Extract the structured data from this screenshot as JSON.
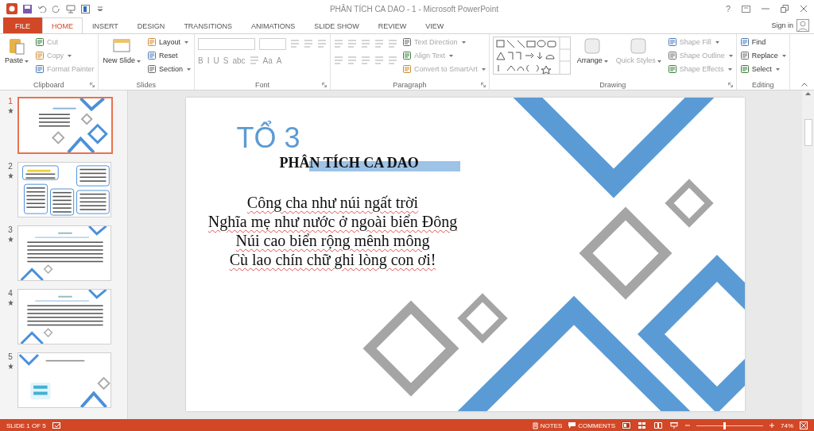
{
  "window": {
    "title": "PHÂN TÍCH CA DAO - 1 - Microsoft PowerPoint",
    "help": "?"
  },
  "tabs": [
    {
      "label": "FILE",
      "kind": "file",
      "selected": false
    },
    {
      "label": "HOME",
      "kind": "tab",
      "selected": true
    },
    {
      "label": "INSERT",
      "kind": "tab",
      "selected": false
    },
    {
      "label": "DESIGN",
      "kind": "tab",
      "selected": false
    },
    {
      "label": "TRANSITIONS",
      "kind": "tab",
      "selected": false
    },
    {
      "label": "ANIMATIONS",
      "kind": "tab",
      "selected": false
    },
    {
      "label": "SLIDE SHOW",
      "kind": "tab",
      "selected": false
    },
    {
      "label": "REVIEW",
      "kind": "tab",
      "selected": false
    },
    {
      "label": "VIEW",
      "kind": "tab",
      "selected": false
    }
  ],
  "account": {
    "label": "Sign in"
  },
  "ribbon": {
    "groups": [
      {
        "label": "Clipboard",
        "launcher": true,
        "columns": [
          [
            {
              "kind": "large",
              "label": "Paste",
              "dropdown": true,
              "disabled": false
            }
          ],
          [
            {
              "kind": "small",
              "label": "Cut",
              "dropdown": false,
              "disabled": true
            },
            {
              "kind": "small",
              "label": "Copy",
              "dropdown": true,
              "disabled": true
            },
            {
              "kind": "small",
              "label": "Format Painter",
              "dropdown": false,
              "disabled": true
            }
          ]
        ]
      },
      {
        "label": "Slides",
        "launcher": false,
        "columns": [
          [
            {
              "kind": "large",
              "label": "New Slide",
              "dropdown": true,
              "disabled": false
            }
          ],
          [
            {
              "kind": "small",
              "label": "Layout",
              "dropdown": true,
              "disabled": false
            },
            {
              "kind": "small",
              "label": "Reset",
              "dropdown": false,
              "disabled": false
            },
            {
              "kind": "small",
              "label": "Section",
              "dropdown": true,
              "disabled": false
            }
          ]
        ]
      },
      {
        "label": "Font",
        "launcher": true,
        "columns": [
          [
            {
              "kind": "row",
              "items": [
                {
                  "kind": "font_field"
                },
                {
                  "kind": "size_field"
                },
                {
                  "kind": "tool"
                },
                {
                  "kind": "tool"
                },
                {
                  "kind": "tool"
                }
              ]
            },
            {
              "kind": "row",
              "items": [
                {
                  "kind": "letter",
                  "label": "B"
                },
                {
                  "kind": "letter",
                  "label": "I"
                },
                {
                  "kind": "letter",
                  "label": "U"
                },
                {
                  "kind": "letter",
                  "label": "S"
                },
                {
                  "kind": "letter",
                  "label": "abc"
                },
                {
                  "kind": "tool"
                },
                {
                  "kind": "letter",
                  "label": "Aa"
                },
                {
                  "kind": "letter",
                  "label": "A"
                }
              ]
            }
          ]
        ]
      },
      {
        "label": "Paragraph",
        "launcher": true,
        "columns": [
          [
            {
              "kind": "row",
              "items": [
                {
                  "kind": "tool"
                },
                {
                  "kind": "tool"
                },
                {
                  "kind": "tool"
                },
                {
                  "kind": "tool"
                },
                {
                  "kind": "tool"
                }
              ]
            },
            {
              "kind": "row",
              "items": [
                {
                  "kind": "tool"
                },
                {
                  "kind": "tool"
                },
                {
                  "kind": "tool"
                },
                {
                  "kind": "tool"
                },
                {
                  "kind": "tool"
                }
              ]
            }
          ],
          [
            {
              "kind": "small",
              "label": "Text Direction",
              "dropdown": true,
              "disabled": true
            },
            {
              "kind": "small",
              "label": "Align Text",
              "dropdown": true,
              "disabled": true
            },
            {
              "kind": "small",
              "label": "Convert to SmartArt",
              "dropdown": true,
              "disabled": true
            }
          ]
        ]
      },
      {
        "label": "Drawing",
        "launcher": true,
        "columns": [
          [
            {
              "kind": "gallery"
            }
          ],
          [
            {
              "kind": "large",
              "label": "Arrange",
              "dropdown": true,
              "disabled": false
            }
          ],
          [
            {
              "kind": "large",
              "label": "Quick Styles",
              "dropdown": true,
              "disabled": true
            }
          ],
          [
            {
              "kind": "small",
              "label": "Shape Fill",
              "dropdown": true,
              "disabled": true
            },
            {
              "kind": "small",
              "label": "Shape Outline",
              "dropdown": true,
              "disabled": true
            },
            {
              "kind": "small",
              "label": "Shape Effects",
              "dropdown": true,
              "disabled": true
            }
          ]
        ]
      },
      {
        "label": "Editing",
        "launcher": false,
        "columns": [
          [
            {
              "kind": "small",
              "label": "Find",
              "dropdown": false,
              "disabled": false
            },
            {
              "kind": "small",
              "label": "Replace",
              "dropdown": true,
              "disabled": false
            },
            {
              "kind": "small",
              "label": "Select",
              "dropdown": true,
              "disabled": false
            }
          ]
        ]
      }
    ]
  },
  "slides": [
    {
      "number": "1",
      "kind": "title",
      "selected": true
    },
    {
      "number": "2",
      "kind": "diagram",
      "selected": false
    },
    {
      "number": "3",
      "kind": "text",
      "selected": false
    },
    {
      "number": "4",
      "kind": "text",
      "selected": false
    },
    {
      "number": "5",
      "kind": "closing",
      "selected": false
    }
  ],
  "slide": {
    "heading": "TỔ 3",
    "title": "PHÂN TÍCH CA DAO",
    "lines": [
      "Công cha như núi ngất trời",
      "Nghĩa mẹ như nước ở ngoài biển Đông",
      "Núi cao biển rộng mênh mông",
      "Cù lao chín chữ ghi lòng con ơi!"
    ]
  },
  "status_bar": {
    "slide_info": "SLIDE 1 OF 5",
    "notes": "NOTES",
    "comments": "COMMENTS",
    "views": [
      {
        "kind": "normal",
        "selected": true
      },
      {
        "kind": "sorter",
        "selected": false
      },
      {
        "kind": "reading",
        "selected": false
      },
      {
        "kind": "show",
        "selected": false
      }
    ],
    "zoom": {
      "level": 0.4,
      "reading": "74%"
    }
  }
}
